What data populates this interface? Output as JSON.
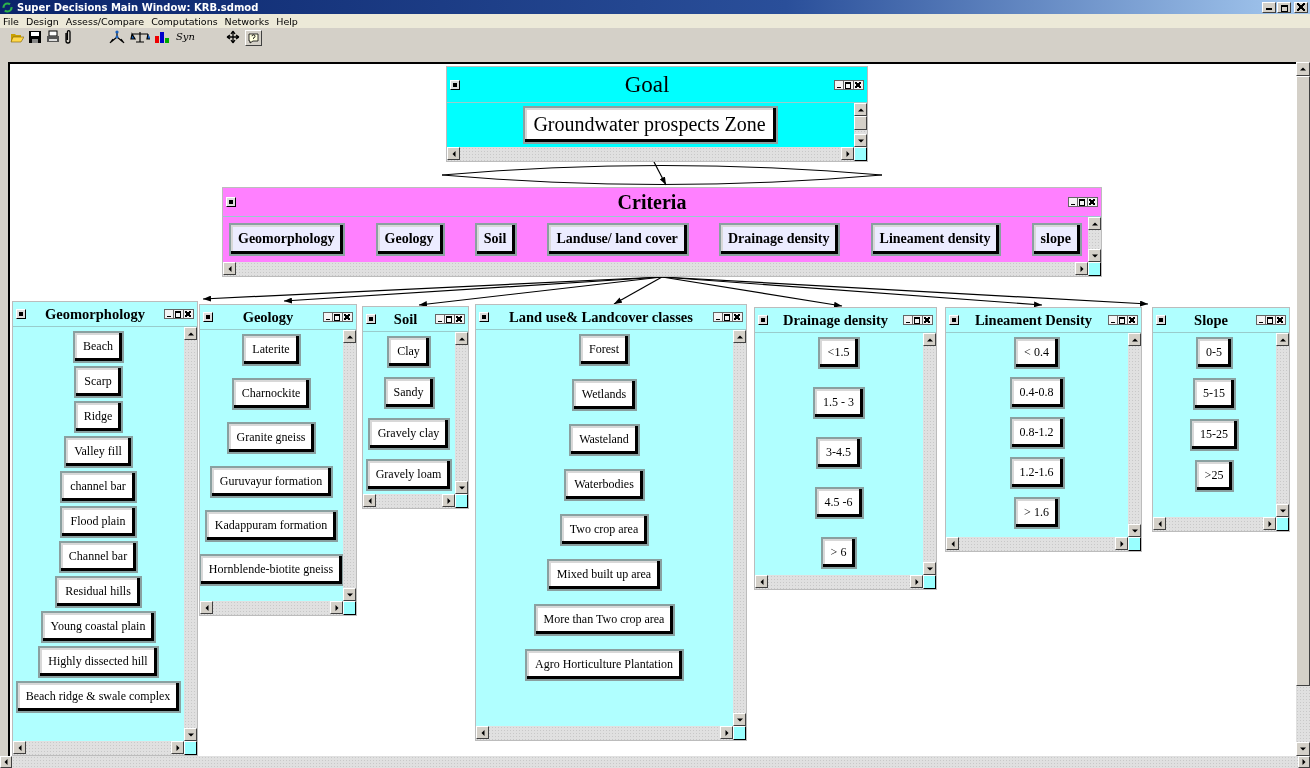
{
  "window": {
    "title": "Super Decisions Main Window: KRB.sdmod"
  },
  "menu": [
    "File",
    "Design",
    "Assess/Compare",
    "Computations",
    "Networks",
    "Help"
  ],
  "toolbar": {
    "synthesis_button": "Syn"
  },
  "clusters": [
    {
      "title": "Goal",
      "kind": "goal",
      "color": "#00ffff",
      "nodes": [
        "Groundwater prospects Zone"
      ]
    },
    {
      "title": "Criteria",
      "kind": "criteria",
      "color": "#ff80ff",
      "nodes": [
        "Geomorphology",
        "Geology",
        "Soil",
        "Landuse/ land cover",
        "Drainage density",
        "Lineament density",
        "slope"
      ]
    },
    {
      "title": "Geomorphology",
      "kind": "classes",
      "color": "#b0ffff",
      "nodes": [
        "Beach",
        "Scarp",
        "Ridge",
        "Valley fill",
        "channel bar",
        "Flood plain",
        "Channel bar",
        "Residual hills",
        "Young coastal plain",
        "Highly dissected hill",
        "Beach ridge & swale complex"
      ]
    },
    {
      "title": "Geology",
      "kind": "classes",
      "color": "#b0ffff",
      "nodes": [
        "Laterite",
        "Charnockite",
        "Granite gneiss",
        "Guruvayur formation",
        "Kadappuram formation",
        "Hornblende-biotite gneiss"
      ]
    },
    {
      "title": "Soil",
      "kind": "classes",
      "color": "#b0ffff",
      "nodes": [
        "Clay",
        "Sandy",
        "Gravely clay",
        "Gravely loam"
      ]
    },
    {
      "title": "Land use& Landcover classes",
      "kind": "classes",
      "color": "#b0ffff",
      "nodes": [
        "Forest",
        "Wetlands",
        "Wasteland",
        "Waterbodies",
        "Two crop area",
        "Mixed built up area",
        "More than Two crop area",
        "Agro Horticulture Plantation"
      ]
    },
    {
      "title": "Drainage density",
      "kind": "classes",
      "color": "#b0ffff",
      "nodes": [
        "<1.5",
        "1.5 - 3",
        "3-4.5",
        "4.5 -6",
        "> 6"
      ]
    },
    {
      "title": "Lineament Density",
      "kind": "classes",
      "color": "#b0ffff",
      "nodes": [
        "< 0.4",
        "0.4-0.8",
        "0.8-1.2",
        "1.2-1.6",
        "> 1.6"
      ]
    },
    {
      "title": "Slope",
      "kind": "classes",
      "color": "#b0ffff",
      "nodes": [
        "0-5",
        "5-15",
        "15-25",
        ">25"
      ]
    }
  ]
}
